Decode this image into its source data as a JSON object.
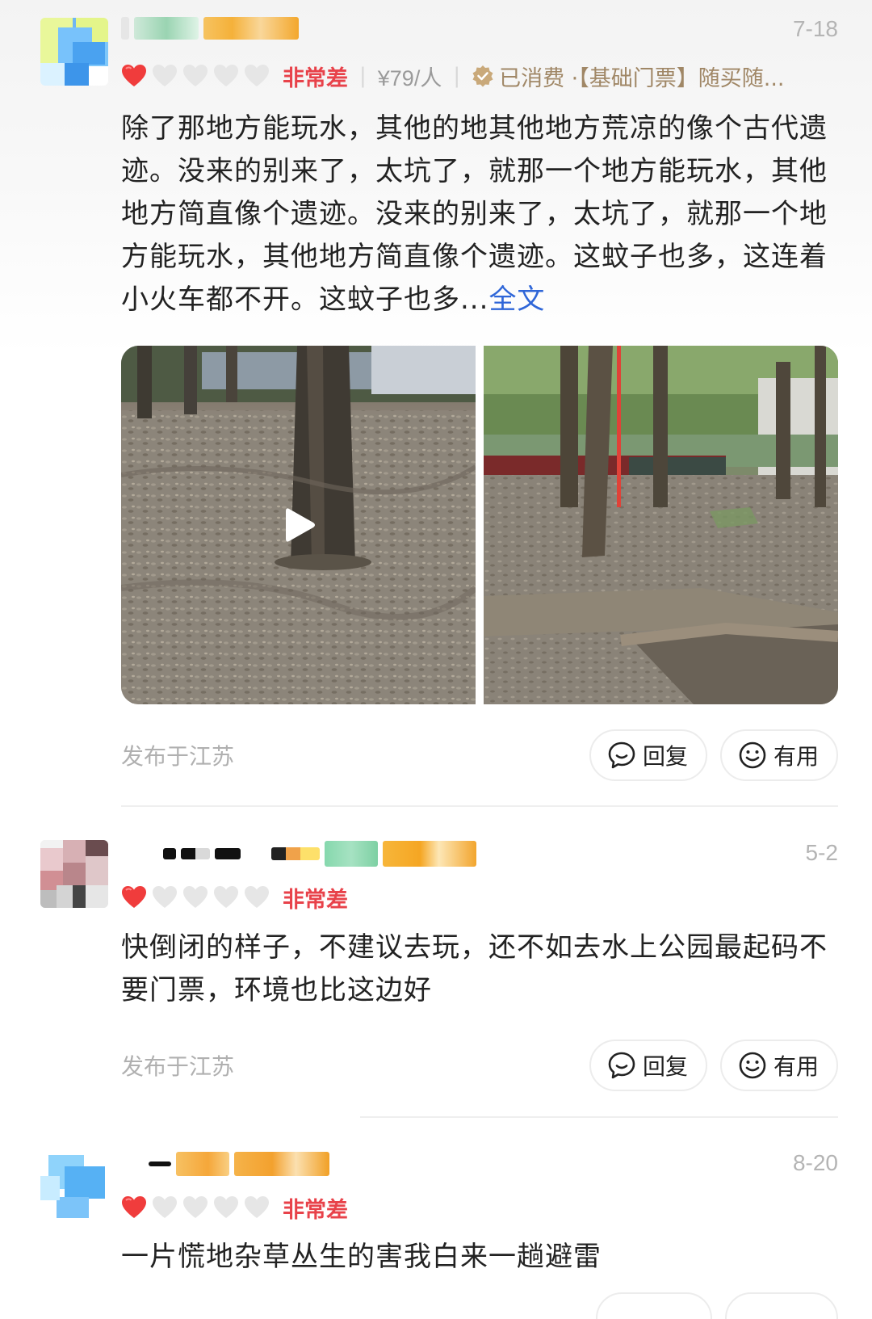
{
  "reviews": [
    {
      "date": "7-18",
      "rating_label": "非常差",
      "price": "¥79/人",
      "consumed": "已消费 ·【基础门票】随买随...",
      "text": "除了那地方能玩水，其他的地其他地方荒凉的像个古代遗迹。没来的别来了，太坑了，就那一个地方能玩水，其他地方简直像个遗迹。没来的别来了，太坑了，就那一个地方能玩水，其他地方简直像个遗迹。这蚊子也多，这连着小火车都不开。这蚊子也多...",
      "more_label": "全文",
      "location": "发布于江苏",
      "reply_label": "回复",
      "useful_label": "有用"
    },
    {
      "date": "5-2",
      "rating_label": "非常差",
      "text": "快倒闭的样子，不建议去玩，还不如去水上公园最起码不要门票，环境也比这边好",
      "location": "发布于江苏",
      "reply_label": "回复",
      "useful_label": "有用"
    },
    {
      "date": "8-20",
      "rating_label": "非常差",
      "text": "一片慌地杂草丛生的害我白来一趟避雷"
    }
  ],
  "rating": {
    "filled_hearts": 1,
    "total_hearts": 5
  },
  "colors": {
    "rating_red": "#e8424a",
    "link_blue": "#2f66d8",
    "consumed_gold": "#a08766",
    "muted_gray": "#b0b0b0"
  },
  "icons": {
    "heart": "heart-icon",
    "consumed": "verified-badge-icon",
    "reply": "chat-bubble-icon",
    "useful": "smiley-icon",
    "play": "play-icon"
  }
}
